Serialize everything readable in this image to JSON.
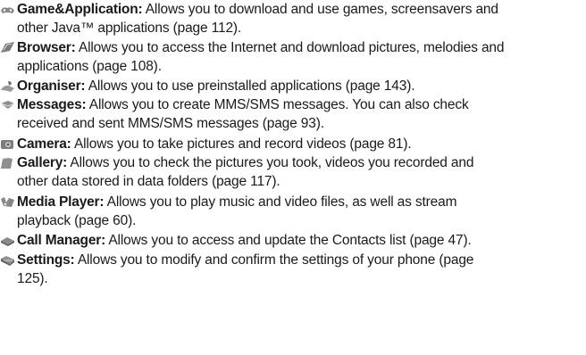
{
  "items": [
    {
      "icon": "game-controller-icon",
      "title": "Game&Application:",
      "line1": " Allows you to download and use games, screensavers and",
      "line2": "other Java™ applications (page 112)."
    },
    {
      "icon": "globe-browser-icon",
      "title": "Browser:",
      "line1": " Allows you to access the Internet and download pictures, melodies and",
      "line2": "applications (page 108)."
    },
    {
      "icon": "organiser-icon",
      "title": "Organiser:",
      "line1": " Allows you to use preinstalled applications (page 143).",
      "line2": ""
    },
    {
      "icon": "envelope-icon",
      "title": "Messages:",
      "line1": " Allows you to create MMS/SMS messages. You can also check",
      "line2": "received and sent MMS/SMS messages (page 93)."
    },
    {
      "icon": "camera-icon",
      "title": "Camera:",
      "line1": " Allows you to take pictures and record videos (page 81).",
      "line2": ""
    },
    {
      "icon": "folder-icon",
      "title": "Gallery:",
      "line1": " Allows you to check the pictures you took, videos you recorded and",
      "line2": "other data stored in data folders (page 117)."
    },
    {
      "icon": "media-player-icon",
      "title": "Media Player:",
      "line1": " Allows you to play music and video files, as well as stream",
      "line2": "playback (page 60)."
    },
    {
      "icon": "call-manager-icon",
      "title": "Call Manager:",
      "line1": " Allows you to access and update the Contacts list (page 47).",
      "line2": ""
    },
    {
      "icon": "settings-icon",
      "title": "Settings:",
      "line1": " Allows you to modify and confirm the settings of your phone (page",
      "line2": "125)."
    }
  ]
}
